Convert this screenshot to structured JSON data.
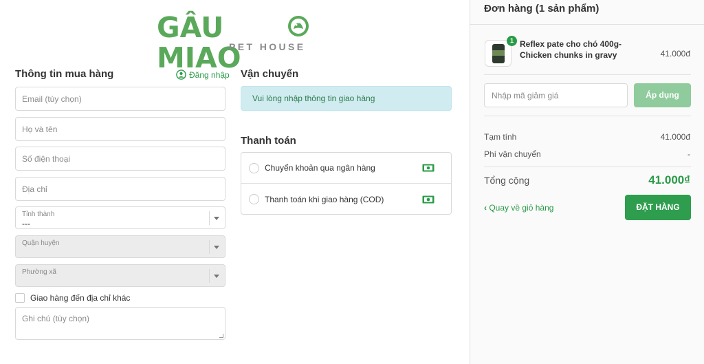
{
  "logo": {
    "main": "GÂU MIAO",
    "sub": "PET HOUSE"
  },
  "customer": {
    "title": "Thông tin mua hàng",
    "login_label": "Đăng nhập",
    "email_placeholder": "Email (tùy chọn)",
    "name_placeholder": "Họ và tên",
    "phone_placeholder": "Số điện thoại",
    "address_placeholder": "Địa chỉ",
    "province": {
      "label": "Tỉnh thành",
      "value": "---"
    },
    "district": {
      "label": "Quận huyện",
      "value": ""
    },
    "ward": {
      "label": "Phường xã",
      "value": ""
    },
    "other_address_label": "Giao hàng đến địa chỉ khác",
    "note_placeholder": "Ghi chú (tùy chọn)"
  },
  "shipping": {
    "title": "Vận chuyển",
    "message": "Vui lòng nhập thông tin giao hàng"
  },
  "payment": {
    "title": "Thanh toán",
    "options": [
      {
        "label": "Chuyển khoản qua ngân hàng",
        "icon": "cash-icon"
      },
      {
        "label": "Thanh toán khi giao hàng (COD)",
        "icon": "cash-icon"
      }
    ]
  },
  "order": {
    "title": "Đơn hàng (1 sản phẩm)",
    "item": {
      "qty": "1",
      "name": "Reflex pate cho chó 400g-Chicken chunks in gravy",
      "price": "41.000đ"
    },
    "discount_placeholder": "Nhập mã giảm giá",
    "apply_label": "Áp dụng",
    "subtotal_label": "Tạm tính",
    "subtotal_value": "41.000đ",
    "shipping_fee_label": "Phí vận chuyển",
    "shipping_fee_value": "-",
    "total_label": "Tổng cộng",
    "total_value": "41.000₫",
    "back_label": "Quay về giỏ hàng",
    "place_order_label": "ĐẶT HÀNG"
  },
  "colors": {
    "brand_green": "#2a9b48",
    "logo_green": "#5aa95a",
    "alert_bg": "#d1ecf1",
    "apply_disabled": "#8fcb9c"
  }
}
